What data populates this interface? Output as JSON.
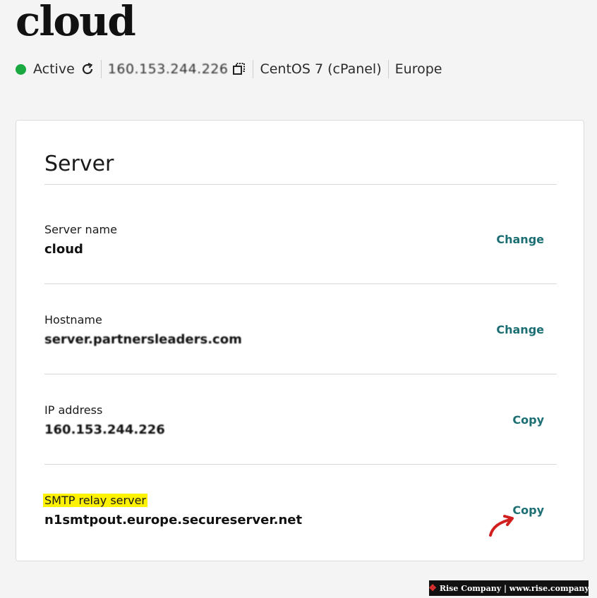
{
  "page": {
    "title": "cloud"
  },
  "status": {
    "state": "Active",
    "ip": "160.153.244.226",
    "os": "CentOS 7 (cPanel)",
    "region": "Europe",
    "dot_color": "#1aa841"
  },
  "card": {
    "title": "Server",
    "rows": [
      {
        "label": "Server name",
        "value": "cloud",
        "action": "Change"
      },
      {
        "label": "Hostname",
        "value": "server.partnersleaders.com",
        "action": "Change"
      },
      {
        "label": "IP address",
        "value": "160.153.244.226",
        "action": "Copy"
      },
      {
        "label": "SMTP relay server",
        "value": "n1smtpout.europe.secureserver.net",
        "action": "Copy"
      }
    ]
  },
  "icons": {
    "refresh": "refresh-icon",
    "copy": "copy-icon",
    "arrow": "red-arrow-annotation"
  },
  "watermark": {
    "text": "Rise Company | www.rise.company"
  },
  "colors": {
    "action": "#1b6f73",
    "highlight": "#fff200",
    "arrow": "#d11f1f"
  }
}
